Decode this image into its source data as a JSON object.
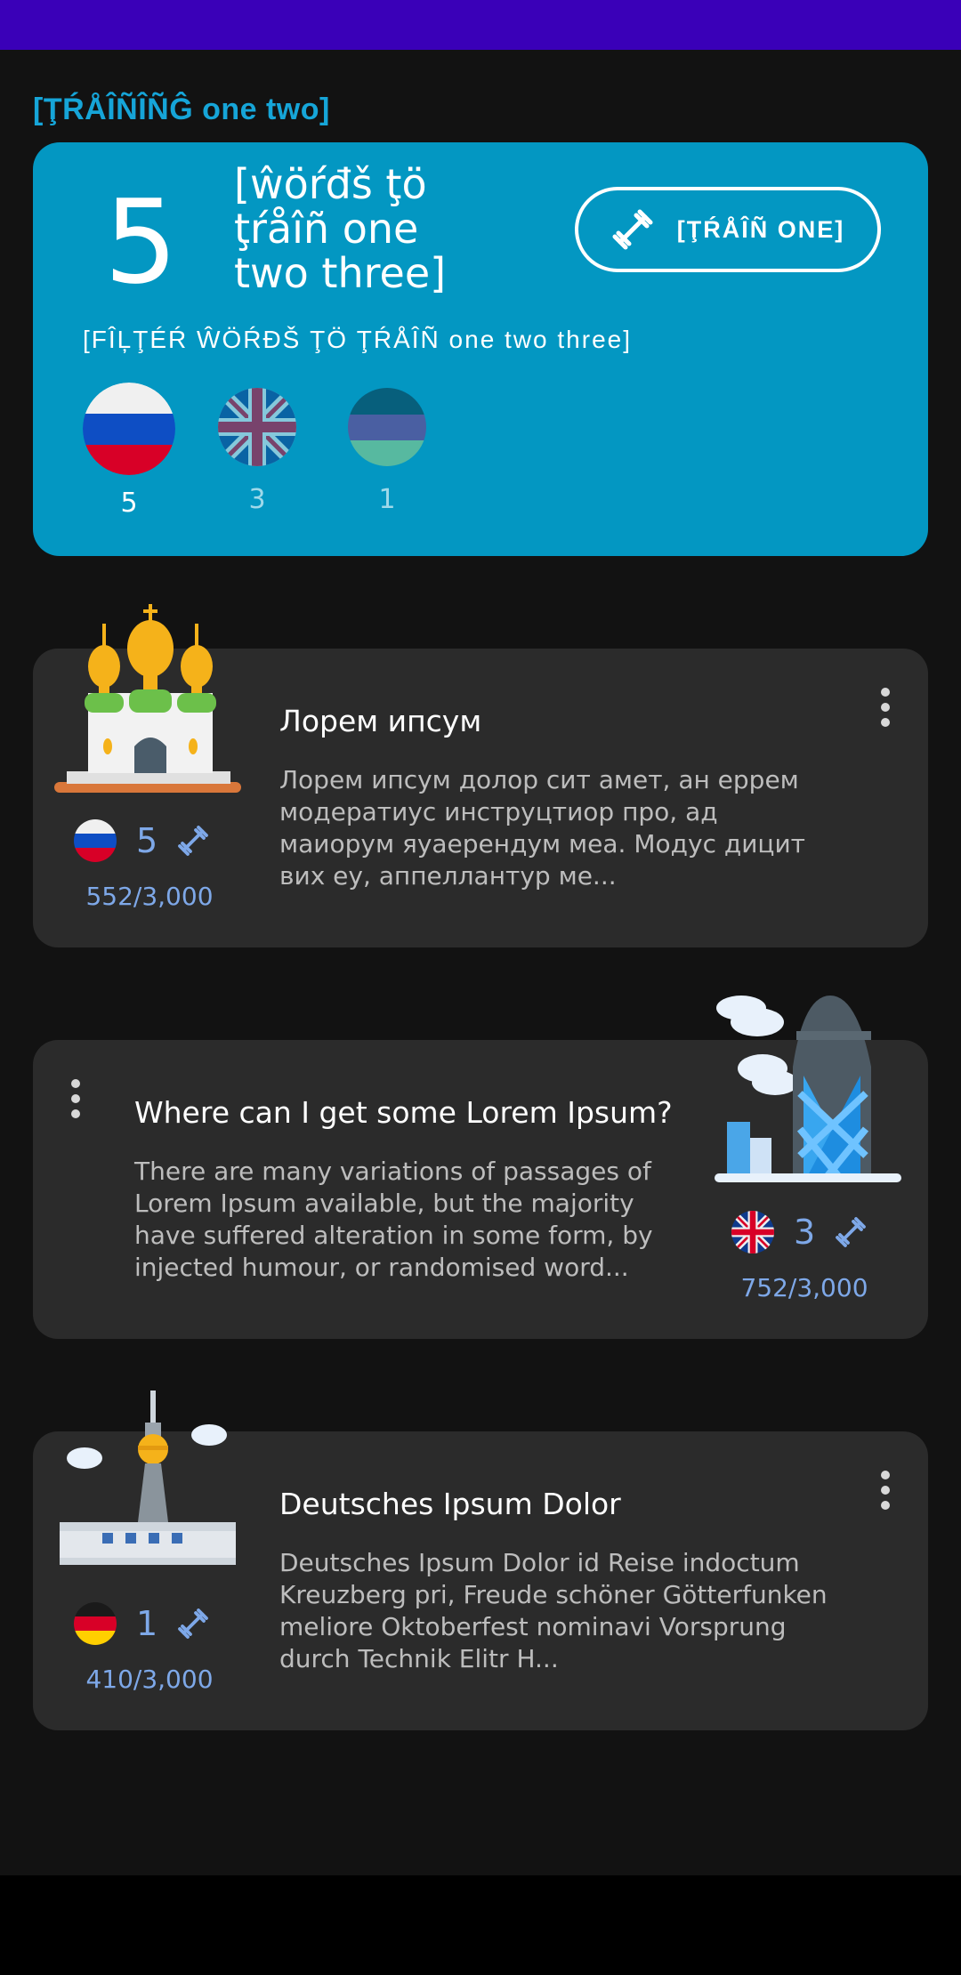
{
  "section": {
    "title": "[ŢŔÅÎÑÎÑĜ one two]"
  },
  "train": {
    "count": "5",
    "words_title": "[ŵöŕđš ţö ţŕåîñ one two three]",
    "button_label": "[ŢŔÅÎÑ ONE]",
    "filter_label": "[FÎĻŢÉŔ ŴÖŔĐŠ ŢÖ ŢŔÅÎÑ one two three]",
    "languages": [
      {
        "flag": "russia-flag",
        "count": "5",
        "selected": true
      },
      {
        "flag": "uk-flag",
        "count": "3",
        "selected": false
      },
      {
        "flag": "mixed-flag",
        "count": "1",
        "selected": false
      }
    ]
  },
  "courses": [
    {
      "title": "Лорем ипсум",
      "description": "Лорем ипсум долор сит амет, ан еррем модератиус инструцтиор про, ад маиорум яуаерендум меа. Модус дицит вих еу, аппеллантур ме...",
      "flag": "russia-flag",
      "count": "5",
      "progress": "552/3,000",
      "illustration": "cathedral-illustration"
    },
    {
      "title": "Where can I get some Lorem Ipsum?",
      "description": "There are many variations of passages of Lorem Ipsum available, but the majority have suffered alteration in some form, by injected humour, or randomised word...",
      "flag": "uk-flag",
      "count": "3",
      "progress": "752/3,000",
      "illustration": "gherkin-illustration"
    },
    {
      "title": "Deutsches Ipsum Dolor",
      "description": "Deutsches Ipsum Dolor id Reise indoctum Kreuzberg pri, Freude schöner Götterfunken meliore Oktoberfest nominavi Vorsprung durch Technik Elitr H...",
      "flag": "germany-flag",
      "count": "1",
      "progress": "410/3,000",
      "illustration": "tv-tower-illustration"
    }
  ],
  "colors": {
    "accent": "#0397c2",
    "card": "#2b2b2b",
    "status_bar": "#3a00b8",
    "progress": "#7ea8e8"
  }
}
